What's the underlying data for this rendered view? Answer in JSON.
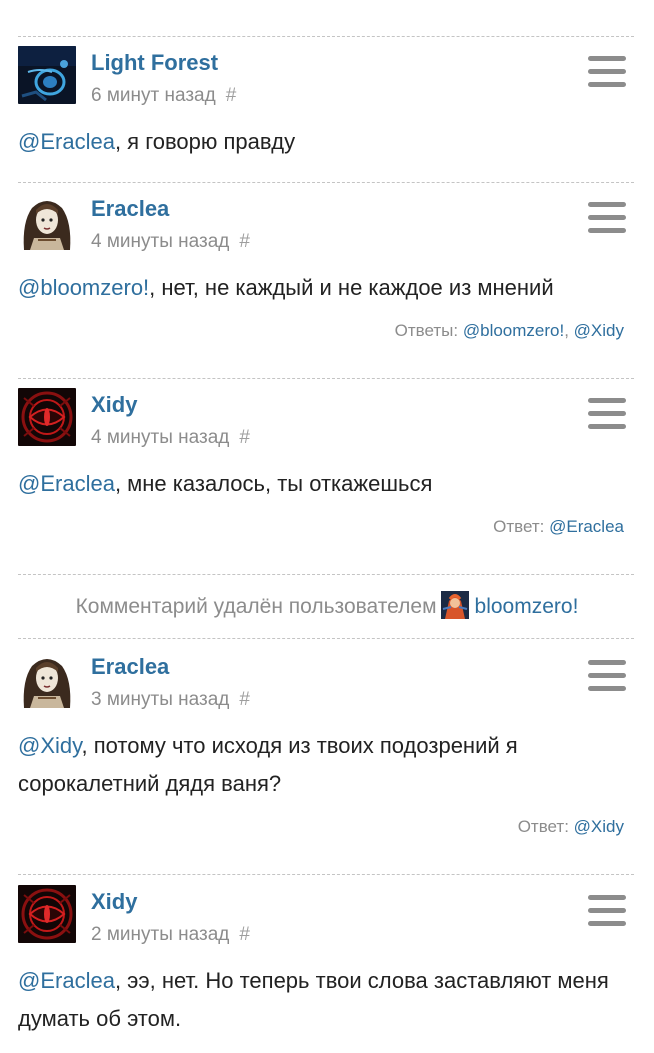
{
  "comments": [
    {
      "author": "Light Forest",
      "time": "6 минут назад",
      "hash": "#",
      "mention": "@Eraclea",
      "text": ", я говорю правду",
      "replies_label": "",
      "replies": [],
      "avatar": "light-forest-avatar"
    },
    {
      "author": "Eraclea",
      "time": "4 минуты назад",
      "hash": "#",
      "mention": "@bloomzero!",
      "text": ", нет, не каждый и не каждое из мнений",
      "replies_label": "Ответы:",
      "replies": [
        "@bloomzero!",
        "@Xidy"
      ],
      "avatar": "eraclea-avatar"
    },
    {
      "author": "Xidy",
      "time": "4 минуты назад",
      "hash": "#",
      "mention": "@Eraclea",
      "text": ", мне казалось, ты откажешься",
      "replies_label": "Ответ:",
      "replies": [
        "@Eraclea"
      ],
      "avatar": "xidy-avatar"
    },
    {
      "author": "Eraclea",
      "time": "3 минуты назад",
      "hash": "#",
      "mention": "@Xidy",
      "text": ", потому что исходя из твоих подозрений я сорокалетний дядя ваня?",
      "replies_label": "Ответ:",
      "replies": [
        "@Xidy"
      ],
      "avatar": "eraclea-avatar"
    },
    {
      "author": "Xidy",
      "time": "2 минуты назад",
      "hash": "#",
      "mention": "@Eraclea",
      "text": ", ээ, нет. Но теперь твои слова заставляют меня думать об этом.",
      "replies_label": "",
      "replies": [],
      "avatar": "xidy-avatar"
    }
  ],
  "deleted_notice": {
    "text": "Комментарий удалён пользователем",
    "user": "bloomzero!"
  },
  "colors": {
    "link": "#2f6f9e",
    "muted": "#8c8c8c",
    "text": "#222222",
    "separator": "#c4c4c4"
  }
}
